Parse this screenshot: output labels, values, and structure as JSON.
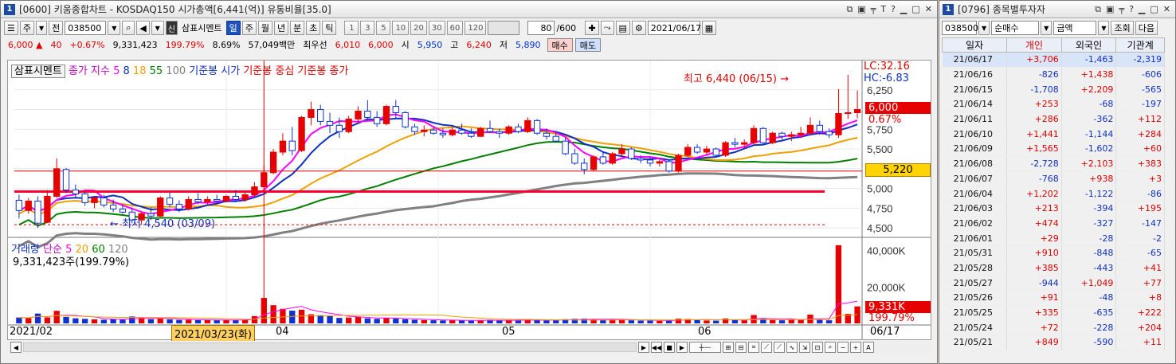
{
  "chart_window": {
    "no": "1",
    "title": "[0600] 키움종합차트 - KOSDAQ150 시가총액[6,441(억)] 유통비율[35.0]",
    "toolbar": {
      "period_week": "주",
      "prev": "전",
      "code": "038500",
      "name": "삼표시멘트",
      "intervals": [
        "일",
        "주",
        "월",
        "년",
        "분",
        "초",
        "틱"
      ],
      "active_interval": "일",
      "numbers": [
        "1",
        "3",
        "5",
        "10",
        "20",
        "30",
        "60",
        "120"
      ],
      "count": "80",
      "total": "/600",
      "date": "2021/06/17",
      "badge": "신"
    },
    "quote": {
      "price": "6,000",
      "change": "40",
      "change_pct": "+0.67%",
      "volume": "9,331,423",
      "vol_pct": "199.79%",
      "turnover": "8.69%",
      "amount": "57,049백만",
      "pref_label": "최우선",
      "pref": "6,010",
      "pref2": "6,000",
      "open_l": "시",
      "open": "5,950",
      "high_l": "고",
      "high": "6,240",
      "low_l": "저",
      "low": "5,890",
      "buy": "매수",
      "sell": "매도"
    },
    "legend": {
      "name": "삼표시멘트",
      "ma_label": "종가 지수",
      "ma": [
        "5",
        "8",
        "18",
        "55",
        "100"
      ],
      "ref": [
        "기준봉 시가",
        "기준봉 중심",
        "기준봉 종가"
      ],
      "lc": "LC:32.16",
      "hc": "HC:-6.83"
    },
    "annotations": {
      "max": "최고 6,440 (06/15) →",
      "min": "← 최저 4,540 (03/09)"
    },
    "price_labels": {
      "last": "6,000",
      "pct": "0.67%",
      "line": "5,220"
    },
    "volume": {
      "label": "거래량",
      "ma_label": "단순",
      "ma": [
        "5",
        "20",
        "60",
        "120"
      ],
      "value": "9,331,423주(199.79%)",
      "last": "9,331K",
      "pct": "199.79%"
    },
    "x_labels": [
      "2021/02",
      "04",
      "05",
      "06",
      "06/17"
    ],
    "cursor_date": "2021/03/23(화)",
    "colors": {
      "up": "#e60000",
      "down": "#1030d0",
      "ma5": "#ff00ff",
      "ma8": "#1030c0",
      "ma18": "#f0a000",
      "ma55": "#008000",
      "ma100": "#808080",
      "ref_line": "#ff0033"
    }
  },
  "chart_data": {
    "type": "candlestick",
    "y_ticks": [
      "6,250",
      "5,750",
      "5,500",
      "5,250",
      "5,000",
      "4,750",
      "4,500"
    ],
    "vol_ticks": [
      "40,000K",
      "20,000K"
    ],
    "ylim": [
      4400,
      6500
    ],
    "vol_max": 46000,
    "candles": [
      [
        4850,
        4920,
        4620,
        4720,
        3200
      ],
      [
        4720,
        4880,
        4680,
        4840,
        2900
      ],
      [
        4840,
        4900,
        4500,
        4560,
        5400
      ],
      [
        4570,
        4980,
        4560,
        4900,
        3300
      ],
      [
        4900,
        5380,
        4880,
        5250,
        6900
      ],
      [
        5240,
        5260,
        4940,
        4980,
        3600
      ],
      [
        4980,
        5050,
        4880,
        4930,
        2800
      ],
      [
        4930,
        4960,
        4780,
        4820,
        2500
      ],
      [
        4820,
        4900,
        4750,
        4880,
        2200
      ],
      [
        4880,
        4920,
        4760,
        4790,
        2000
      ],
      [
        4790,
        4860,
        4700,
        4740,
        2400
      ],
      [
        4740,
        4800,
        4680,
        4700,
        2100
      ],
      [
        4700,
        4760,
        4560,
        4600,
        3800
      ],
      [
        4600,
        4700,
        4540,
        4680,
        3000
      ],
      [
        4680,
        4760,
        4600,
        4650,
        2300
      ],
      [
        4650,
        4900,
        4640,
        4880,
        2700
      ],
      [
        4880,
        4950,
        4760,
        4800,
        2200
      ],
      [
        4800,
        4850,
        4700,
        4740,
        1900
      ],
      [
        4740,
        4900,
        4720,
        4860,
        2000
      ],
      [
        4860,
        4940,
        4800,
        4830,
        1800
      ],
      [
        4830,
        4900,
        4780,
        4860,
        1800
      ],
      [
        4860,
        4920,
        4820,
        4840,
        1700
      ],
      [
        4840,
        4920,
        4820,
        4900,
        1900
      ],
      [
        4900,
        4980,
        4840,
        4860,
        1800
      ],
      [
        4860,
        4950,
        4830,
        4920,
        2000
      ],
      [
        4920,
        5080,
        4900,
        5020,
        4000
      ],
      [
        5020,
        5300,
        5000,
        5200,
        14000
      ],
      [
        5200,
        5500,
        5180,
        5460,
        10000
      ],
      [
        5460,
        5700,
        5420,
        5600,
        8000
      ],
      [
        5600,
        5780,
        5420,
        5480,
        7000
      ],
      [
        5480,
        5920,
        5460,
        5900,
        7500
      ],
      [
        5900,
        6100,
        5800,
        6000,
        5000
      ],
      [
        6000,
        6060,
        5800,
        5850,
        4500
      ],
      [
        5850,
        5960,
        5700,
        5800,
        4000
      ],
      [
        5800,
        5900,
        5640,
        5720,
        3000
      ],
      [
        5720,
        5920,
        5700,
        5880,
        3200
      ],
      [
        5880,
        6040,
        5820,
        5980,
        3500
      ],
      [
        5980,
        6120,
        5860,
        5900,
        2800
      ],
      [
        5900,
        5980,
        5780,
        5820,
        2500
      ],
      [
        5820,
        6060,
        5800,
        6040,
        3000
      ],
      [
        6040,
        6120,
        5880,
        5960,
        2600
      ],
      [
        5960,
        5980,
        5760,
        5780,
        2300
      ],
      [
        5780,
        5820,
        5680,
        5720,
        2000
      ],
      [
        5720,
        5800,
        5660,
        5740,
        1800
      ],
      [
        5740,
        5780,
        5680,
        5700,
        1700
      ],
      [
        5700,
        5760,
        5640,
        5680,
        1600
      ],
      [
        5680,
        5780,
        5660,
        5740,
        1800
      ],
      [
        5740,
        5820,
        5680,
        5700,
        1600
      ],
      [
        5700,
        5760,
        5640,
        5660,
        1500
      ],
      [
        5660,
        5780,
        5650,
        5760,
        1800
      ],
      [
        5760,
        5860,
        5700,
        5720,
        2000
      ],
      [
        5720,
        5760,
        5640,
        5700,
        1600
      ],
      [
        5700,
        5800,
        5680,
        5780,
        1700
      ],
      [
        5780,
        5820,
        5700,
        5720,
        1500
      ],
      [
        5720,
        5900,
        5700,
        5860,
        2300
      ],
      [
        5860,
        5880,
        5680,
        5700,
        1900
      ],
      [
        5700,
        5760,
        5620,
        5660,
        1600
      ],
      [
        5660,
        5720,
        5580,
        5600,
        1700
      ],
      [
        5600,
        5640,
        5420,
        5440,
        2300
      ],
      [
        5440,
        5500,
        5300,
        5320,
        2500
      ],
      [
        5320,
        5380,
        5180,
        5240,
        2600
      ],
      [
        5240,
        5420,
        5220,
        5400,
        2400
      ],
      [
        5400,
        5460,
        5300,
        5320,
        1800
      ],
      [
        5320,
        5460,
        5300,
        5440,
        2100
      ],
      [
        5440,
        5560,
        5400,
        5500,
        2200
      ],
      [
        5500,
        5520,
        5360,
        5380,
        1700
      ],
      [
        5380,
        5420,
        5320,
        5360,
        1500
      ],
      [
        5360,
        5400,
        5280,
        5320,
        1500
      ],
      [
        5320,
        5380,
        5280,
        5340,
        1400
      ],
      [
        5340,
        5360,
        5200,
        5220,
        1800
      ],
      [
        5220,
        5440,
        5200,
        5420,
        2600
      ],
      [
        5420,
        5560,
        5400,
        5520,
        2400
      ],
      [
        5520,
        5560,
        5440,
        5460,
        1800
      ],
      [
        5460,
        5540,
        5420,
        5500,
        1600
      ],
      [
        5500,
        5520,
        5400,
        5420,
        1500
      ],
      [
        5420,
        5600,
        5400,
        5580,
        2700
      ],
      [
        5580,
        5640,
        5520,
        5560,
        2000
      ],
      [
        5560,
        5620,
        5500,
        5580,
        1700
      ],
      [
        5580,
        5800,
        5560,
        5760,
        4600
      ],
      [
        5760,
        5780,
        5560,
        5580,
        2500
      ],
      [
        5580,
        5720,
        5560,
        5700,
        1800
      ],
      [
        5700,
        5720,
        5620,
        5660,
        1700
      ],
      [
        5660,
        5720,
        5600,
        5680,
        1900
      ],
      [
        5680,
        5780,
        5640,
        5700,
        2100
      ],
      [
        5700,
        5900,
        5680,
        5800,
        4800
      ],
      [
        5800,
        5860,
        5680,
        5720,
        1900
      ],
      [
        5720,
        5760,
        5640,
        5680,
        1700
      ],
      [
        5680,
        6260,
        5640,
        5950,
        43000
      ],
      [
        5950,
        6440,
        5880,
        5960,
        5200
      ],
      [
        5960,
        6240,
        5890,
        6000,
        9331
      ]
    ]
  },
  "investor_window": {
    "no": "1",
    "title": "[0796] 종목별투자자",
    "code": "038500",
    "mode": "순매수",
    "unit": "금액",
    "query": "조회",
    "next": "다음",
    "headers": [
      "일자",
      "개인",
      "외국인",
      "기관계"
    ],
    "rows": [
      [
        "21/06/17",
        "+3,706",
        "-1,463",
        "-2,319"
      ],
      [
        "21/06/16",
        "-826",
        "+1,438",
        "-606"
      ],
      [
        "21/06/15",
        "-1,708",
        "+2,209",
        "-565"
      ],
      [
        "21/06/14",
        "+253",
        "-68",
        "-197"
      ],
      [
        "21/06/11",
        "+286",
        "-362",
        "+112"
      ],
      [
        "21/06/10",
        "+1,441",
        "-1,144",
        "+284"
      ],
      [
        "21/06/09",
        "+1,565",
        "-1,602",
        "+60"
      ],
      [
        "21/06/08",
        "-2,728",
        "+2,103",
        "+383"
      ],
      [
        "21/06/07",
        "-768",
        "+938",
        "+3"
      ],
      [
        "21/06/04",
        "+1,202",
        "-1,122",
        "-86"
      ],
      [
        "21/06/03",
        "+213",
        "-394",
        "+195"
      ],
      [
        "21/06/02",
        "+474",
        "-327",
        "-147"
      ],
      [
        "21/06/01",
        "+29",
        "-28",
        "-2"
      ],
      [
        "21/05/31",
        "+910",
        "-848",
        "-65"
      ],
      [
        "21/05/28",
        "+385",
        "-443",
        "+41"
      ],
      [
        "21/05/27",
        "-944",
        "+1,049",
        "+77"
      ],
      [
        "21/05/26",
        "+91",
        "-48",
        "+8"
      ],
      [
        "21/05/25",
        "+335",
        "-635",
        "+222"
      ],
      [
        "21/05/24",
        "+72",
        "-228",
        "+204"
      ],
      [
        "21/05/21",
        "+849",
        "-590",
        "+11"
      ]
    ]
  }
}
